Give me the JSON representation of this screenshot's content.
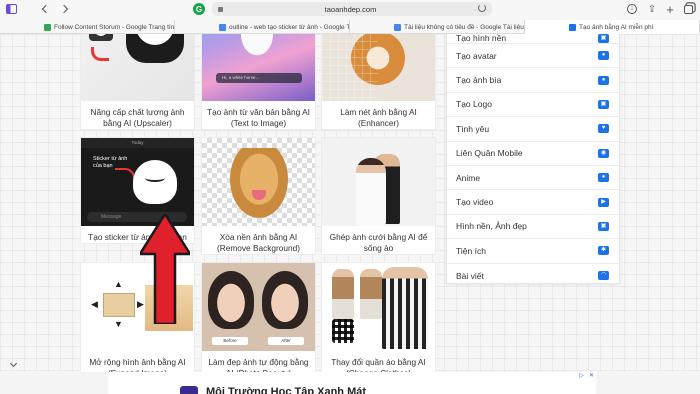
{
  "browser": {
    "url": "taoanhdep.com",
    "tabs": [
      {
        "title": "Follow Content Storum - Google Trang tính",
        "icon_color": "#34a853",
        "active": false
      },
      {
        "title": "outline - web tạo sticker từ ảnh - Google Tài liệu",
        "icon_color": "#4285f4",
        "active": false
      },
      {
        "title": "Tài liệu không có tiêu đề - Google Tài liệu",
        "icon_color": "#4285f4",
        "active": false
      },
      {
        "title": "Tạo ảnh bằng AI miễn phí",
        "icon_color": "#1a73e8",
        "active": true
      }
    ]
  },
  "cards": [
    {
      "title": "Nâng cấp chất lượng ảnh bằng AI (Upscaler)",
      "thumb": "upscale"
    },
    {
      "title": "Tạo ảnh từ văn bản bằng AI (Text to Image)",
      "thumb": "text2img",
      "prompt_text": "Hi, a white horse..."
    },
    {
      "title": "Làm nét ảnh bằng AI (Enhancer)",
      "thumb": "enhance"
    },
    {
      "title": "Tạo sticker từ ảnh của bạn",
      "thumb": "sticker",
      "overlay_text": "Sticker từ ảnh của bạn",
      "input_placeholder": "Message",
      "topbar_text": "Today"
    },
    {
      "title": "Xóa nền ảnh bằng AI (Remove Background)",
      "thumb": "removebg"
    },
    {
      "title": "Ghép ảnh cưới bằng AI để sống ảo",
      "thumb": "wedding"
    },
    {
      "title": "Mở rộng hình ảnh bằng AI (Expand Image)",
      "thumb": "outpaint"
    },
    {
      "title": "Làm đẹp ảnh tự động bằng AI (Photo Beauty)",
      "thumb": "beauty",
      "before_label": "Before",
      "after_label": "After"
    },
    {
      "title": "Thay đổi quần áo bằng AI (Change Clothes)",
      "thumb": "clothes"
    }
  ],
  "menu": {
    "items": [
      {
        "label": "Tạo hình nền",
        "icon": "image-icon"
      },
      {
        "label": "Tạo avatar",
        "icon": "user-icon"
      },
      {
        "label": "Tạo ảnh bìa",
        "icon": "user-icon"
      },
      {
        "label": "Tạo Logo",
        "icon": "picture-icon"
      },
      {
        "label": "Tình yêu",
        "icon": "heart-icon"
      },
      {
        "label": "Liên Quân Mobile",
        "icon": "gamepad-icon"
      },
      {
        "label": "Anime",
        "icon": "user-icon"
      },
      {
        "label": "Tạo video",
        "icon": "video-icon"
      },
      {
        "label": "Hình nền, Ảnh đẹp",
        "icon": "image-icon"
      },
      {
        "label": "Tiện ích",
        "icon": "tools-icon"
      },
      {
        "label": "Bài viết",
        "icon": "rss-icon"
      }
    ],
    "accent": "#1a73e8"
  },
  "ad": {
    "headline": "Môi Trường Học Tập Xanh Mát"
  },
  "colors": {
    "arrow": "#e0202a",
    "page_bg": "#f6f6f6"
  }
}
